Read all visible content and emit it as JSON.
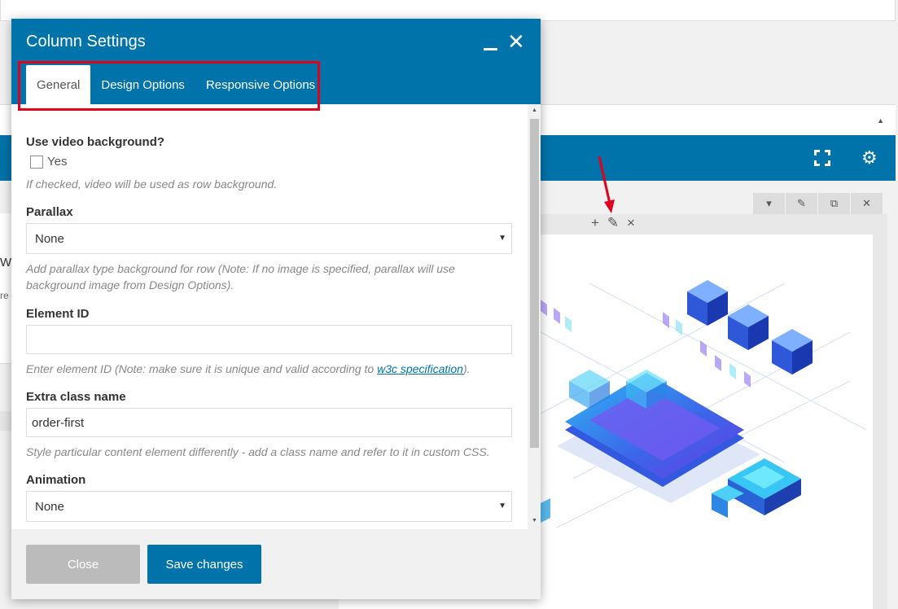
{
  "dialog": {
    "title": "Column Settings",
    "tabs": [
      {
        "label": "General",
        "active": true
      },
      {
        "label": "Design Options",
        "active": false
      },
      {
        "label": "Responsive Options",
        "active": false
      }
    ],
    "highlight_color": "#e3001b"
  },
  "fields": {
    "video_bg": {
      "label": "Use video background?",
      "checkbox_label": "Yes",
      "checked": false,
      "help": "If checked, video will be used as row background."
    },
    "parallax": {
      "label": "Parallax",
      "value": "None",
      "help": "Add parallax type background for row (Note: If no image is specified, parallax will use background image from Design Options)."
    },
    "element_id": {
      "label": "Element ID",
      "value": "",
      "help_prefix": "Enter element ID (Note: make sure it is unique and valid according to ",
      "help_link": "w3c specification",
      "help_suffix": ")."
    },
    "extra_class": {
      "label": "Extra class name",
      "value": "order-first",
      "help": "Style particular content element differently - add a class name and refer to it in custom CSS."
    },
    "animation": {
      "label": "Animation",
      "value": "None"
    }
  },
  "footer": {
    "close_label": "Close",
    "save_label": "Save changes"
  },
  "background": {
    "left_letter": "W",
    "left_letter2": "re",
    "toolbar_icons": [
      "fullscreen-icon",
      "gear-icon"
    ],
    "row_controls": [
      "chevron-down-icon",
      "pencil-icon",
      "copy-icon",
      "close-icon"
    ],
    "column_controls": [
      "plus-icon",
      "pencil-icon",
      "close-icon"
    ]
  },
  "colors": {
    "primary": "#0073aa",
    "annotation": "#e3001b"
  }
}
